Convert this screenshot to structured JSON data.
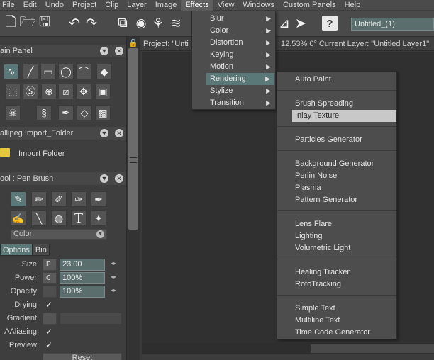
{
  "menubar": [
    "File",
    "Edit",
    "Undo",
    "Project",
    "Clip",
    "Layer",
    "Image",
    "Effects",
    "View",
    "Windows",
    "Custom Panels",
    "Help"
  ],
  "toolbar": {
    "title_field": "Untitled_(1)"
  },
  "panels": {
    "main_panel": "ain Panel",
    "import_panel": "allipeg Import_Folder",
    "import_item": "Import Folder",
    "tool_panel": "ool : Pen Brush",
    "color_label": "Color",
    "tab_options": "Options",
    "tab_bin": "Bin"
  },
  "properties": {
    "size_label": "Size",
    "size_box": "P",
    "size_value": "23.00",
    "power_label": "Power",
    "power_box": "C",
    "power_value": "100%",
    "opacity_label": "Opacity",
    "opacity_value": "100%",
    "drying_label": "Drying",
    "gradient_label": "Gradient",
    "aaliasing_label": "AAliasing",
    "preview_label": "Preview",
    "reset_label": "Reset"
  },
  "infobar": {
    "project": "Project: \"Unti",
    "status": "12.53%  0°  Current Layer: \"Untitled Layer1\""
  },
  "effects_menu": [
    "Blur",
    "Color",
    "Distortion",
    "Keying",
    "Motion",
    "Rendering",
    "Stylize",
    "Transition"
  ],
  "rendering_menu": {
    "groups": [
      [
        "Auto Paint"
      ],
      [
        "Brush Spreading",
        "Inlay Texture"
      ],
      [
        "Particles Generator"
      ],
      [
        "Background Generator",
        "Perlin Noise",
        "Plasma",
        "Pattern Generator"
      ],
      [
        "Lens Flare",
        "Lighting",
        "Volumetric Light"
      ],
      [
        "Healing Tracker",
        "RotoTracking"
      ],
      [
        "Simple Text",
        "Multiline Text",
        "Time Code Generator"
      ]
    ]
  },
  "colors": {
    "highlight": "#5b7878",
    "selected": "#c8c8c8",
    "folder": "#e6c93a"
  }
}
